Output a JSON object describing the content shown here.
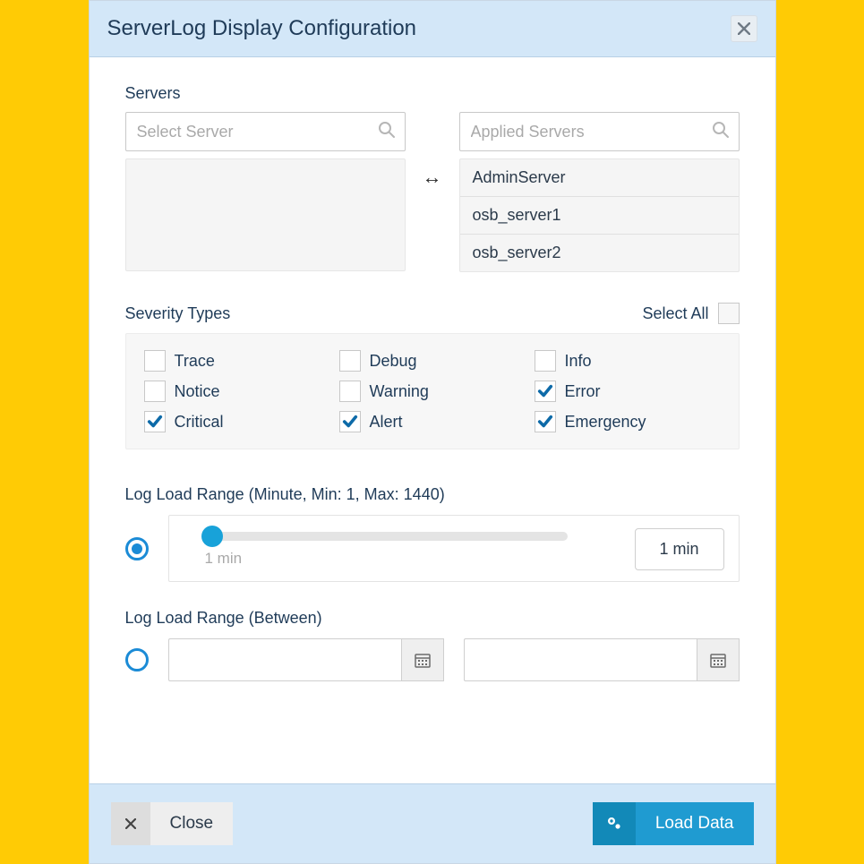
{
  "header": {
    "title": "ServerLog Display Configuration"
  },
  "servers": {
    "label": "Servers",
    "left_placeholder": "Select Server",
    "right_placeholder": "Applied Servers",
    "applied": [
      "AdminServer",
      "osb_server1",
      "osb_server2"
    ]
  },
  "severity": {
    "label": "Severity Types",
    "select_all_label": "Select All",
    "select_all_checked": false,
    "items": [
      {
        "label": "Trace",
        "checked": false
      },
      {
        "label": "Debug",
        "checked": false
      },
      {
        "label": "Info",
        "checked": false
      },
      {
        "label": "Notice",
        "checked": false
      },
      {
        "label": "Warning",
        "checked": false
      },
      {
        "label": "Error",
        "checked": true
      },
      {
        "label": "Critical",
        "checked": true
      },
      {
        "label": "Alert",
        "checked": true
      },
      {
        "label": "Emergency",
        "checked": true
      }
    ]
  },
  "range_minute": {
    "label": "Log Load Range (Minute, Min: 1, Max: 1440)",
    "selected": true,
    "slider_value_label": "1 min",
    "value_box": "1 min"
  },
  "range_between": {
    "label": "Log Load Range (Between)",
    "selected": false
  },
  "footer": {
    "close_label": "Close",
    "load_label": "Load Data"
  }
}
